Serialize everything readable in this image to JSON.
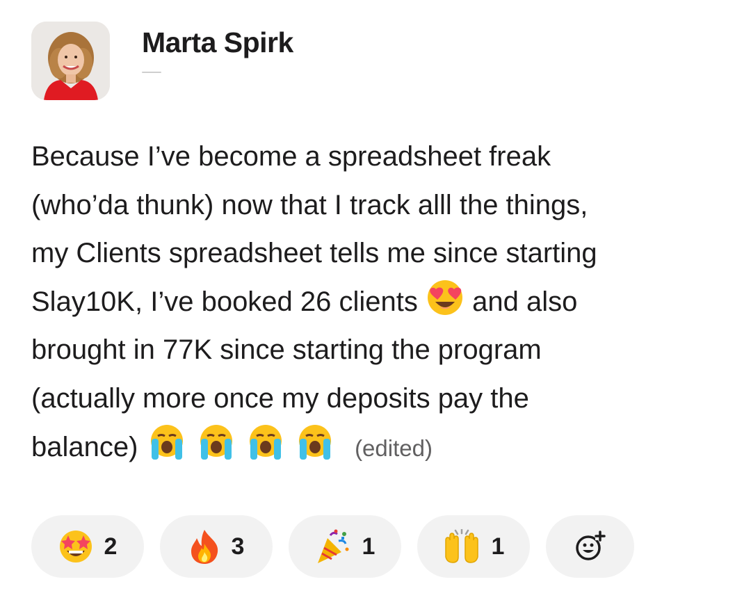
{
  "post": {
    "author": "Marta Spirk",
    "lines": [
      "Because I’ve become a spreadsheet freak",
      "(who’da thunk) now that I track alll the things,",
      "my Clients spreadsheet tells me since starting",
      "Slay10K, I’ve booked 26 clients",
      "and also",
      "brought in 77K since starting the program",
      "(actually more once my deposits pay the",
      "balance)"
    ],
    "edited_label": "(edited)",
    "inline_emoji": [
      "heart-eyes-emoji",
      "loudly-crying-emoji",
      "loudly-crying-emoji",
      "loudly-crying-emoji",
      "loudly-crying-emoji"
    ]
  },
  "reactions": [
    {
      "emoji": "star-struck-emoji",
      "count": "2"
    },
    {
      "emoji": "fire-emoji",
      "count": "3"
    },
    {
      "emoji": "party-popper-emoji",
      "count": "1"
    },
    {
      "emoji": "raising-hands-emoji",
      "count": "1"
    },
    {
      "emoji": "add-reaction-icon",
      "count": ""
    }
  ],
  "colors": {
    "text": "#1d1c1d",
    "muted": "#616061",
    "pill_bg": "#f2f2f2",
    "emoji_yellow": "#fcc21b",
    "tear_blue": "#40c0e7",
    "heart_red": "#f4445f"
  }
}
